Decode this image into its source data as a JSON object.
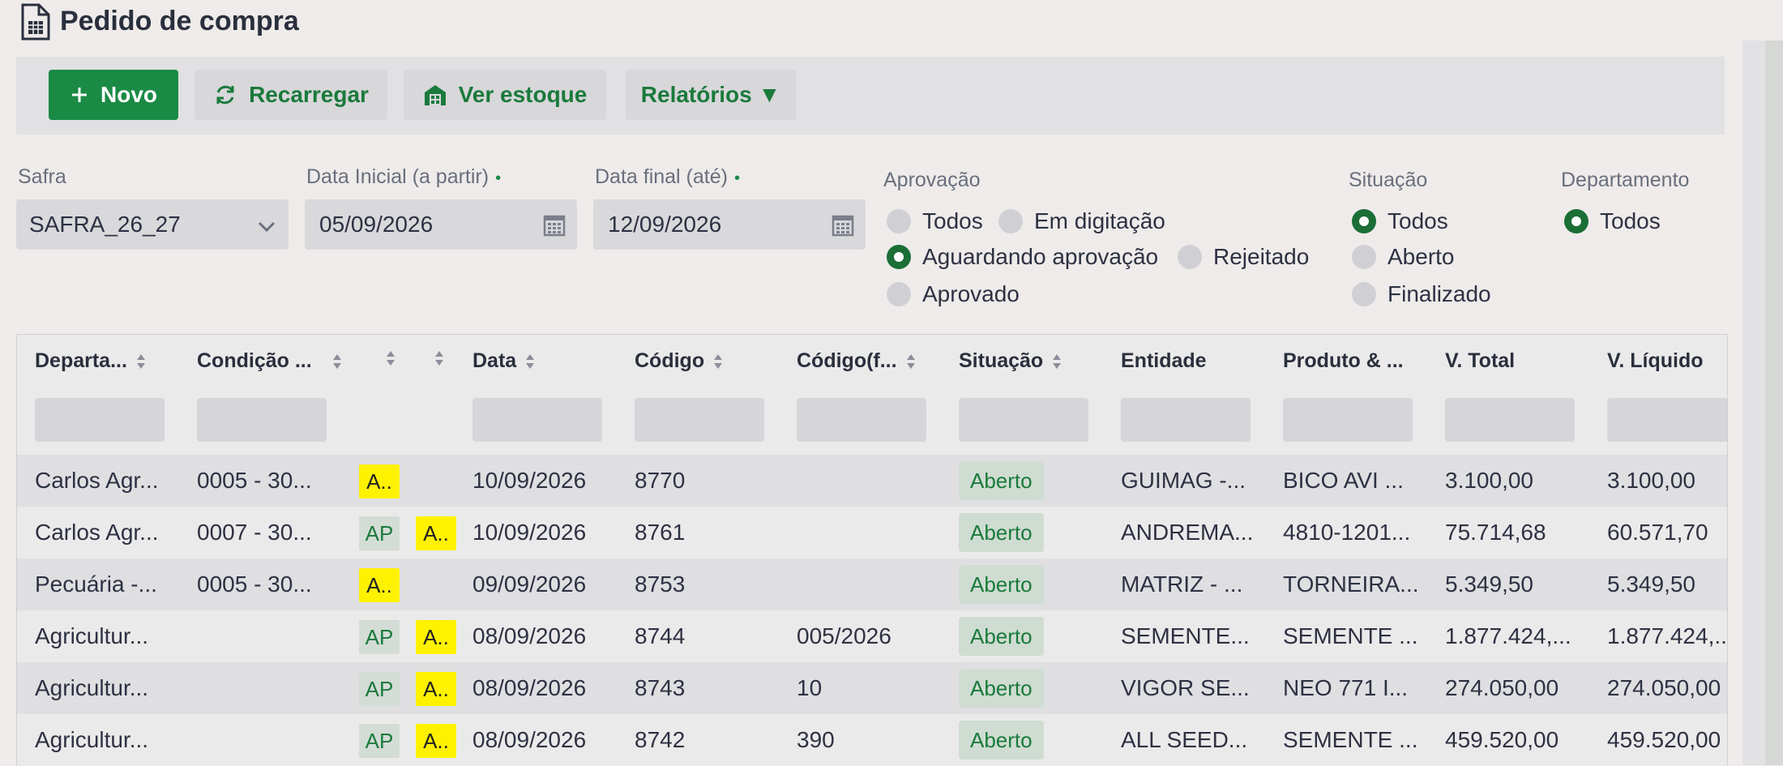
{
  "page": {
    "title": "Pedido de compra"
  },
  "toolbar": {
    "new_label": "Novo",
    "reload_label": "Recarregar",
    "stock_label": "Ver estoque",
    "reports_label": "Relatórios ▼"
  },
  "filters": {
    "safra": {
      "label": "Safra",
      "value": "SAFRA_26_27"
    },
    "start_date": {
      "label": "Data Inicial (a partir)",
      "value": "05/09/2026"
    },
    "end_date": {
      "label": "Data final (até)",
      "value": "12/09/2026"
    },
    "required_dot": "•",
    "approval": {
      "label": "Aprovação",
      "options": [
        "Todos",
        "Em digitação",
        "Aguardando aprovação",
        "Rejeitado",
        "Aprovado"
      ],
      "selected": "Aguardando aprovação"
    },
    "situation": {
      "label": "Situação",
      "options": [
        "Todos",
        "Aberto",
        "Finalizado"
      ],
      "selected": "Todos"
    },
    "department": {
      "label": "Departamento",
      "options": [
        "Todos"
      ],
      "selected": "Todos"
    }
  },
  "table": {
    "columns": [
      "Departa...",
      "Condição ...",
      "Data",
      "Código",
      "Código(f...",
      "Situação",
      "Entidade",
      "Produto & ...",
      "V. Total",
      "V. Líquido"
    ],
    "rows": [
      {
        "dept": "Carlos Agr...",
        "cond": "0005 - 30...",
        "tag1": "A..",
        "tag2": "",
        "date": "10/09/2026",
        "code": "8770",
        "fcode": "",
        "status": "Aberto",
        "entity": "GUIMAG -...",
        "product": "BICO AVI ...",
        "total": "3.100,00",
        "net": "3.100,00"
      },
      {
        "dept": "Carlos Agr...",
        "cond": "0007 - 30...",
        "tag1": "AP",
        "tag2": "A..",
        "date": "10/09/2026",
        "code": "8761",
        "fcode": "",
        "status": "Aberto",
        "entity": "ANDREMA...",
        "product": "4810-1201...",
        "total": "75.714,68",
        "net": "60.571,70"
      },
      {
        "dept": "Pecuária -...",
        "cond": "0005 - 30...",
        "tag1": "A..",
        "tag2": "",
        "date": "09/09/2026",
        "code": "8753",
        "fcode": "",
        "status": "Aberto",
        "entity": "MATRIZ - ...",
        "product": "TORNEIRA...",
        "total": "5.349,50",
        "net": "5.349,50"
      },
      {
        "dept": "Agricultur...",
        "cond": "",
        "tag1": "AP",
        "tag2": "A..",
        "date": "08/09/2026",
        "code": "8744",
        "fcode": "005/2026",
        "status": "Aberto",
        "entity": "SEMENTE...",
        "product": "SEMENTE ...",
        "total": "1.877.424,...",
        "net": "1.877.424,..."
      },
      {
        "dept": "Agricultur...",
        "cond": "",
        "tag1": "AP",
        "tag2": "A..",
        "date": "08/09/2026",
        "code": "8743",
        "fcode": "10",
        "status": "Aberto",
        "entity": "VIGOR SE...",
        "product": "NEO 771 I...",
        "total": "274.050,00",
        "net": "274.050,00"
      },
      {
        "dept": "Agricultur...",
        "cond": "",
        "tag1": "AP",
        "tag2": "A..",
        "date": "08/09/2026",
        "code": "8742",
        "fcode": "390",
        "status": "Aberto",
        "entity": "ALL SEED...",
        "product": "SEMENTE ...",
        "total": "459.520,00",
        "net": "459.520,00"
      }
    ]
  },
  "colors": {
    "accent": "#1a8a45",
    "warning_tag": "#fff200"
  }
}
